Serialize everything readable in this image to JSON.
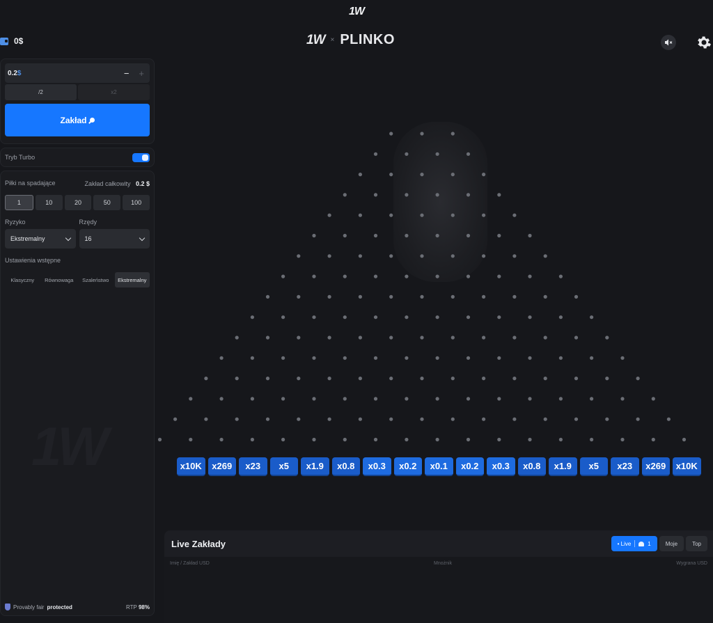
{
  "top_logo": "1W",
  "wallet": {
    "balance": "0$"
  },
  "header": {
    "brand": "1W",
    "cross": "×",
    "game": "PLINKO"
  },
  "bet": {
    "amount": "0.2",
    "currency": "$",
    "minus": "−",
    "plus": "+",
    "halve_label": "/2",
    "double_label": "x2",
    "place_label": "Zakład"
  },
  "turbo": {
    "label": "Tryb Turbo",
    "enabled": true
  },
  "balls": {
    "label": "Piłki na spadające",
    "total_label": "Zakład całkowity",
    "total_value": "0.2 $",
    "options": [
      "1",
      "10",
      "20",
      "50",
      "100"
    ],
    "selected": "1"
  },
  "risk": {
    "label": "Ryzyko",
    "value": "Ekstremalny"
  },
  "rows": {
    "label": "Rzędy",
    "value": "16"
  },
  "presets": {
    "label": "Ustawienia wstępne",
    "options": [
      "Klasyczny",
      "Równowaga",
      "Szaleństwo",
      "Ekstremalny"
    ],
    "selected": "Ekstremalny"
  },
  "sidebar_watermark": "1W",
  "footer": {
    "fair_text": "Provably fair",
    "fair_status": "protected",
    "rtp_label": "RTP",
    "rtp_value": "98%"
  },
  "multipliers": [
    "x10K",
    "x269",
    "x23",
    "x5",
    "x1.9",
    "x0.8",
    "x0.3",
    "x0.2",
    "x0.1",
    "x0.2",
    "x0.3",
    "x0.8",
    "x1.9",
    "x5",
    "x23",
    "x269",
    "x10K"
  ],
  "live": {
    "title": "Live Zakłady",
    "tabs": {
      "live": "• Live",
      "count": "1",
      "mine": "Moje",
      "top": "Top"
    },
    "columns": [
      "Imię / Zakład USD",
      "Mnożnik",
      "Wygrana USD"
    ]
  },
  "colors": {
    "accent": "#1677ff",
    "multiplier": "#1a5cc9",
    "peg": "#6b6e75"
  },
  "icons": [
    "wallet-icon",
    "speaker-muted-icon",
    "gear-icon",
    "pin-icon",
    "shield-icon",
    "users-icon",
    "chevron-down-icon"
  ]
}
